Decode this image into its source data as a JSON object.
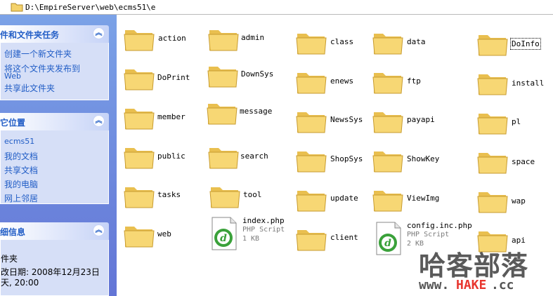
{
  "address": {
    "path": "D:\\EmpireServer\\web\\ecms51\\e"
  },
  "tasks_panel": {
    "title": "件和文件夹任务",
    "items": [
      "创建一个新文件夹",
      "将这个文件夹发布到",
      "Web",
      "共享此文件夹"
    ]
  },
  "places_panel": {
    "title": "它位置",
    "items": [
      "ecms51",
      "我的文档",
      "共享文档",
      "我的电脑",
      "网上邻居"
    ]
  },
  "details_panel": {
    "title": "细信息",
    "type": "件夹",
    "modified": "改日期: 2008年12月23日",
    "modified_time": "天, 20:00"
  },
  "files": [
    {
      "name": "action",
      "kind": "folder"
    },
    {
      "name": "admin",
      "kind": "folder"
    },
    {
      "name": "class",
      "kind": "folder"
    },
    {
      "name": "data",
      "kind": "folder"
    },
    {
      "name": "DoInfo",
      "kind": "folder"
    },
    {
      "name": "DoPrint",
      "kind": "folder"
    },
    {
      "name": "DownSys",
      "kind": "folder"
    },
    {
      "name": "enews",
      "kind": "folder"
    },
    {
      "name": "ftp",
      "kind": "folder"
    },
    {
      "name": "install",
      "kind": "folder"
    },
    {
      "name": "member",
      "kind": "folder"
    },
    {
      "name": "message",
      "kind": "folder"
    },
    {
      "name": "NewsSys",
      "kind": "folder"
    },
    {
      "name": "payapi",
      "kind": "folder"
    },
    {
      "name": "pl",
      "kind": "folder"
    },
    {
      "name": "public",
      "kind": "folder"
    },
    {
      "name": "search",
      "kind": "folder"
    },
    {
      "name": "ShopSys",
      "kind": "folder"
    },
    {
      "name": "ShowKey",
      "kind": "folder"
    },
    {
      "name": "space",
      "kind": "folder"
    },
    {
      "name": "tasks",
      "kind": "folder"
    },
    {
      "name": "tool",
      "kind": "folder"
    },
    {
      "name": "update",
      "kind": "folder"
    },
    {
      "name": "ViewImg",
      "kind": "folder"
    },
    {
      "name": "wap",
      "kind": "folder"
    },
    {
      "name": "web",
      "kind": "folder"
    },
    {
      "name": "index.php",
      "kind": "php",
      "type": "PHP Script",
      "size": "1 KB"
    },
    {
      "name": "client",
      "kind": "folder"
    },
    {
      "name": "config.inc.php",
      "kind": "php",
      "type": "PHP Script",
      "size": "2 KB"
    },
    {
      "name": "api",
      "kind": "folder"
    }
  ],
  "watermark": {
    "cn": "哈客部落",
    "en": "www.HAKE.cc"
  },
  "colors": {
    "taskpane_top": "#7ba2e7",
    "taskpane_bottom": "#6375d6",
    "link": "#215dc6",
    "folder_fill": "#f7d774",
    "dreamweaver_green": "#3aa13a"
  }
}
